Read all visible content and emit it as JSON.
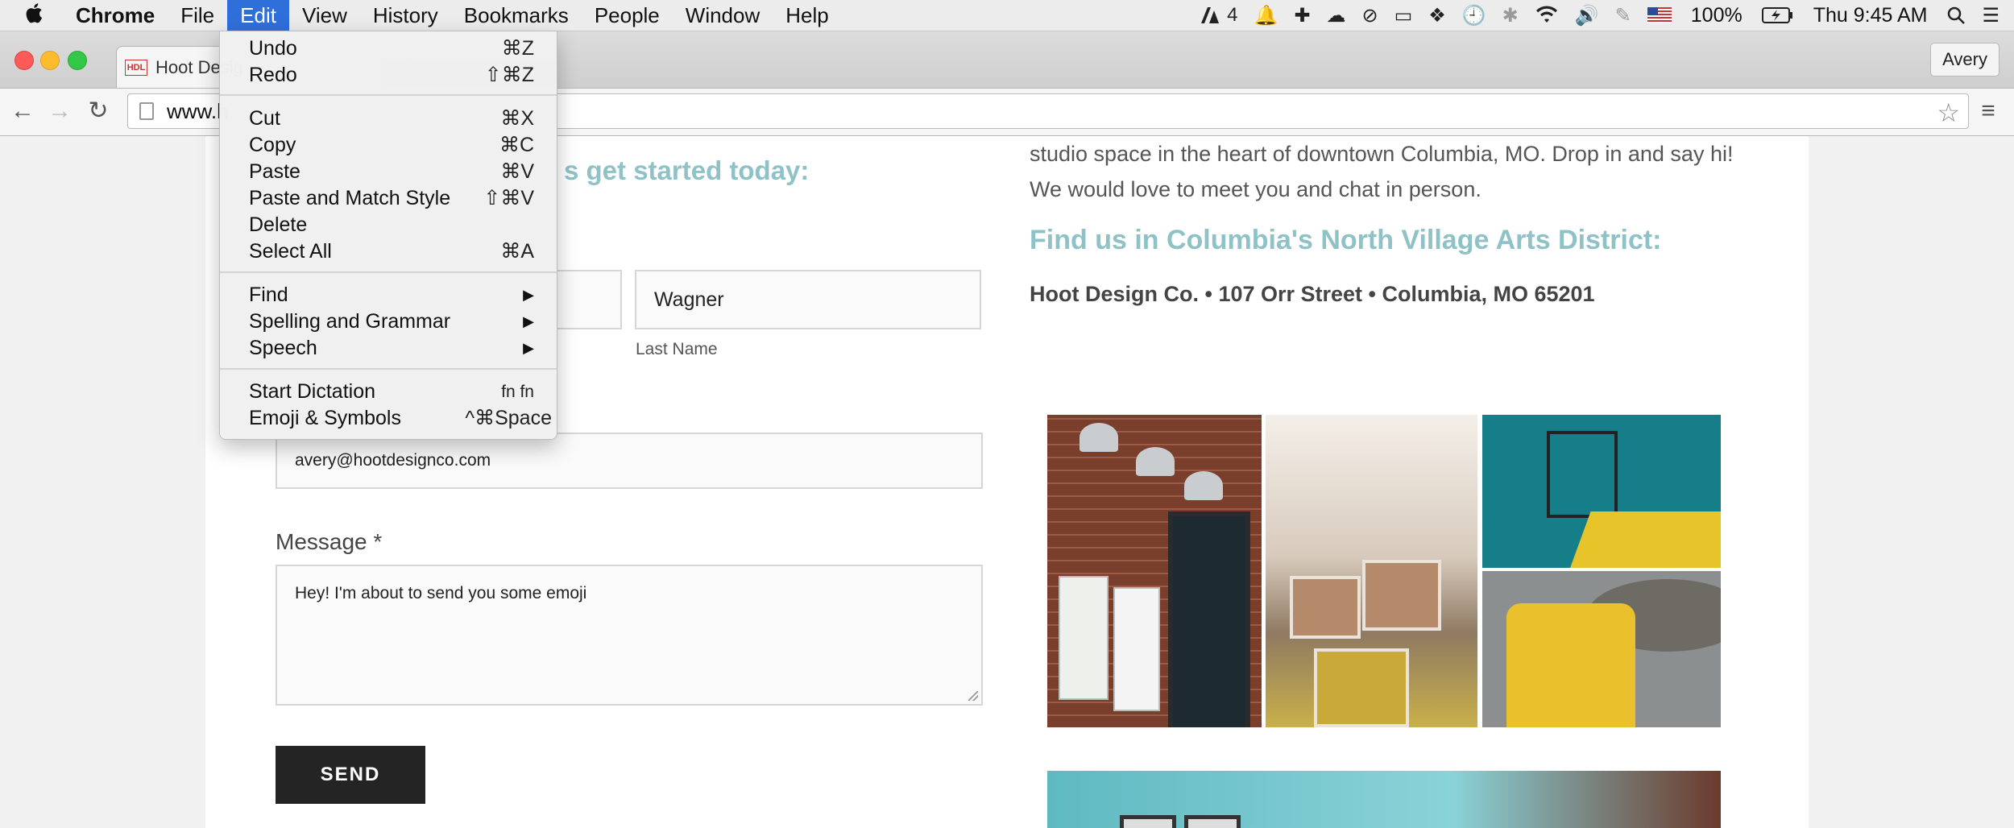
{
  "menubar": {
    "app": "Chrome",
    "menus": [
      "File",
      "Edit",
      "View",
      "History",
      "Bookmarks",
      "People",
      "Window",
      "Help"
    ],
    "active_menu": "Edit",
    "adobe_count": "4",
    "battery": "100%",
    "clock": "Thu 9:45 AM"
  },
  "browser": {
    "tab_title": "Hoot Desig",
    "favicon": "HDL",
    "profile": "Avery",
    "url": "www.h"
  },
  "edit_menu": {
    "groups": [
      [
        {
          "label": "Undo",
          "shortcut": "⌘Z"
        },
        {
          "label": "Redo",
          "shortcut": "⇧⌘Z"
        }
      ],
      [
        {
          "label": "Cut",
          "shortcut": "⌘X"
        },
        {
          "label": "Copy",
          "shortcut": "⌘C"
        },
        {
          "label": "Paste",
          "shortcut": "⌘V"
        },
        {
          "label": "Paste and Match Style",
          "shortcut": "⇧⌘V"
        },
        {
          "label": "Delete",
          "shortcut": ""
        },
        {
          "label": "Select All",
          "shortcut": "⌘A"
        }
      ],
      [
        {
          "label": "Find",
          "shortcut": "▶"
        },
        {
          "label": "Spelling and Grammar",
          "shortcut": "▶"
        },
        {
          "label": "Speech",
          "shortcut": "▶"
        }
      ],
      [
        {
          "label": "Start Dictation",
          "shortcut": "fn fn"
        },
        {
          "label": "Emoji & Symbols",
          "shortcut": "^⌘Space"
        }
      ]
    ]
  },
  "form": {
    "heading_partial": "s get started today:",
    "last_name_value": "Wagner",
    "last_name_label": "Last Name",
    "email_value": "avery@hootdesignco.com",
    "message_label": "Message *",
    "message_value": "Hey! I'm about to send you some emoji",
    "send_label": "SEND"
  },
  "about": {
    "text": "studio space in the heart of downtown Columbia, MO. Drop in and say hi! We would love to meet you and chat in person.",
    "find_heading": "Find us in Columbia's North Village Arts District:",
    "address": "Hoot Design Co. • 107 Orr Street • Columbia, MO 65201"
  },
  "colors": {
    "accent_teal": "#8fc2c6",
    "menu_highlight": "#2f6fda",
    "send_button": "#242424"
  }
}
